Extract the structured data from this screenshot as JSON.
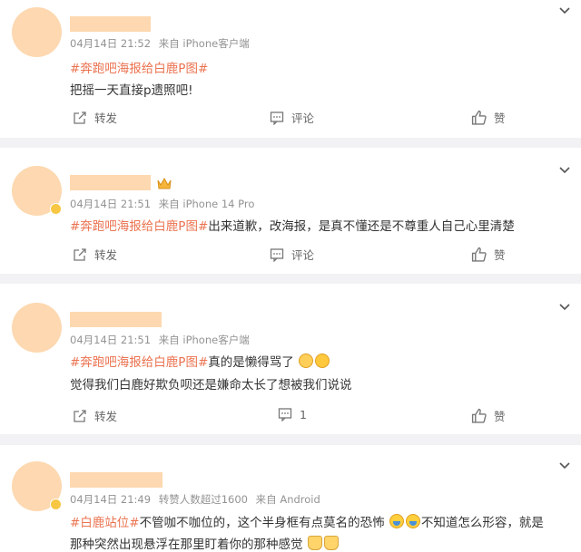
{
  "posts": [
    {
      "time": "04月14日 21:52",
      "source": "来自 iPhone客户端",
      "lines": [
        {
          "hashtag": "#奔跑吧海报给白鹿P图#",
          "text": ""
        },
        {
          "hashtag": "",
          "text": "把摇一天直接p遗照吧!"
        }
      ],
      "repost_label": "转发",
      "comment_label": "评论",
      "like_label": "赞"
    },
    {
      "time": "04月14日 21:51",
      "source": "来自 iPhone 14 Pro",
      "lines": [
        {
          "hashtag": "#奔跑吧海报给白鹿P图#",
          "text": "出来道歉，改海报，是真不懂还是不尊重人自己心里清楚"
        }
      ],
      "repost_label": "转发",
      "comment_label": "评论",
      "like_label": "赞"
    },
    {
      "time": "04月14日 21:51",
      "source": "来自 iPhone客户端",
      "lines": [
        {
          "hashtag": "#奔跑吧海报给白鹿P图#",
          "text": "真的是懒得骂了"
        },
        {
          "hashtag": "",
          "text": "觉得我们白鹿好欺负呗还是嫌命太长了想被我们说说"
        }
      ],
      "repost_label": "转发",
      "comment_label": "1",
      "like_label": "赞"
    },
    {
      "time": "04月14日 21:49",
      "extra": "转赞人数超过1600",
      "source": "来自 Android",
      "lines": [
        {
          "hashtag": "#白鹿站位#",
          "text": "不管咖不咖位的，这个半身框有点莫名的恐怖",
          "text2": "不知道怎么形容，就是"
        },
        {
          "hashtag": "",
          "text": "那种突然出现悬浮在那里盯着你的那种感觉"
        }
      ]
    }
  ],
  "icons": {
    "menu": "chevron-down-icon",
    "repost": "repost-icon",
    "comment": "comment-icon",
    "like": "thumbs-up-icon",
    "emoji_sad": "sad-emoji-icon",
    "emoji_surprised": "surprised-emoji-icon",
    "emoji_sweat": "sweat-emoji-icon",
    "emoji_pray": "pray-emoji-icon",
    "crown": "crown-badge-icon",
    "verified": "verified-badge-icon"
  },
  "colors": {
    "hashtag": "#eb7350",
    "meta": "#939393",
    "avatar_placeholder": "#fdd8b0",
    "background": "#f2f2f5"
  }
}
